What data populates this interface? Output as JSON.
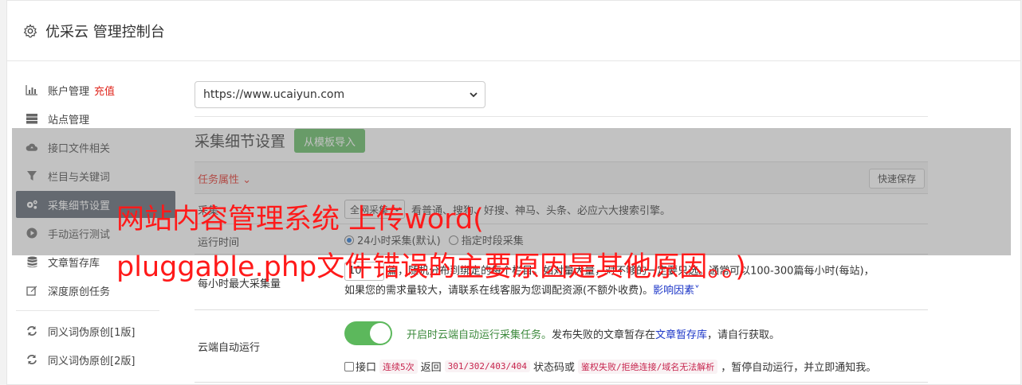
{
  "header": {
    "title": "优采云 管理控制台"
  },
  "sidebar": {
    "items": [
      {
        "label": "账户管理",
        "badge": "充值",
        "icon": "bar-chart-icon"
      },
      {
        "label": "站点管理",
        "icon": "server-icon"
      },
      {
        "label": "接口文件相关",
        "icon": "cloud-upload-icon"
      },
      {
        "label": "栏目与关键词",
        "icon": "filter-icon"
      },
      {
        "label": "采集细节设置",
        "icon": "gears-icon",
        "active": true
      },
      {
        "label": "手动运行测试",
        "icon": "play-circle-icon"
      },
      {
        "label": "文章暂存库",
        "icon": "database-icon"
      },
      {
        "label": "深度原创任务",
        "icon": "edit-icon"
      },
      {
        "label": "同义词伪原创[1版]",
        "icon": "refresh-icon"
      },
      {
        "label": "同义词伪原创[2版]",
        "icon": "refresh-icon"
      }
    ]
  },
  "site_select": {
    "value": "https://www.ucaiyun.com"
  },
  "section": {
    "title": "采集细节设置",
    "import_button": "从模板导入"
  },
  "task_table": {
    "header_label": "任务属性 ",
    "save_button": "快速保存",
    "row1": {
      "label": "采集",
      "select_value": "全网采集",
      "text": "看普通、搜狗、好搜、神马、头条、必应六大搜索引擎。"
    },
    "row2": {
      "label": "运行时间",
      "option1": "24小时采集(默认)",
      "option2": "指定时段采集"
    },
    "row3": {
      "label": "每小时最大采集量",
      "value": "10",
      "text1": "篇，随机分布到绑定的每个栏目。如对量大量，对不够的一定要只选。通常可以100-300篇每小时(每站)，",
      "text2": "如果您的需求量较大，请联系在线客服为您调配资源(不额外收费)。",
      "link": "影响因素"
    },
    "row4": {
      "label": "云端自动运行",
      "toggle_on": true,
      "green_text": "开启时云端自动运行采集任务。",
      "text_a": "发布失败的文章暂存在",
      "link": "文章暂存库",
      "text_b": "，请自行获取。",
      "fail_prefix": "接口",
      "tag1": "连续5次",
      "fail_mid1": "返回",
      "tag2": "301/302/403/404",
      "fail_mid2": "状态码或",
      "tag3": "鉴权失败/拒绝连接/域名无法解析",
      "fail_suffix": "，暂停自动运行，并立即通知我。"
    }
  },
  "watermark": {
    "line1": "网站内容管理系统 上传word(",
    "line2": "pluggable.php文件错误的主要原因是其他原因。。)"
  },
  "colors": {
    "accent_green": "#5cb85c",
    "active_nav": "#555e6b",
    "warning_red": "#e0281f",
    "link_blue": "#1b35c7"
  }
}
